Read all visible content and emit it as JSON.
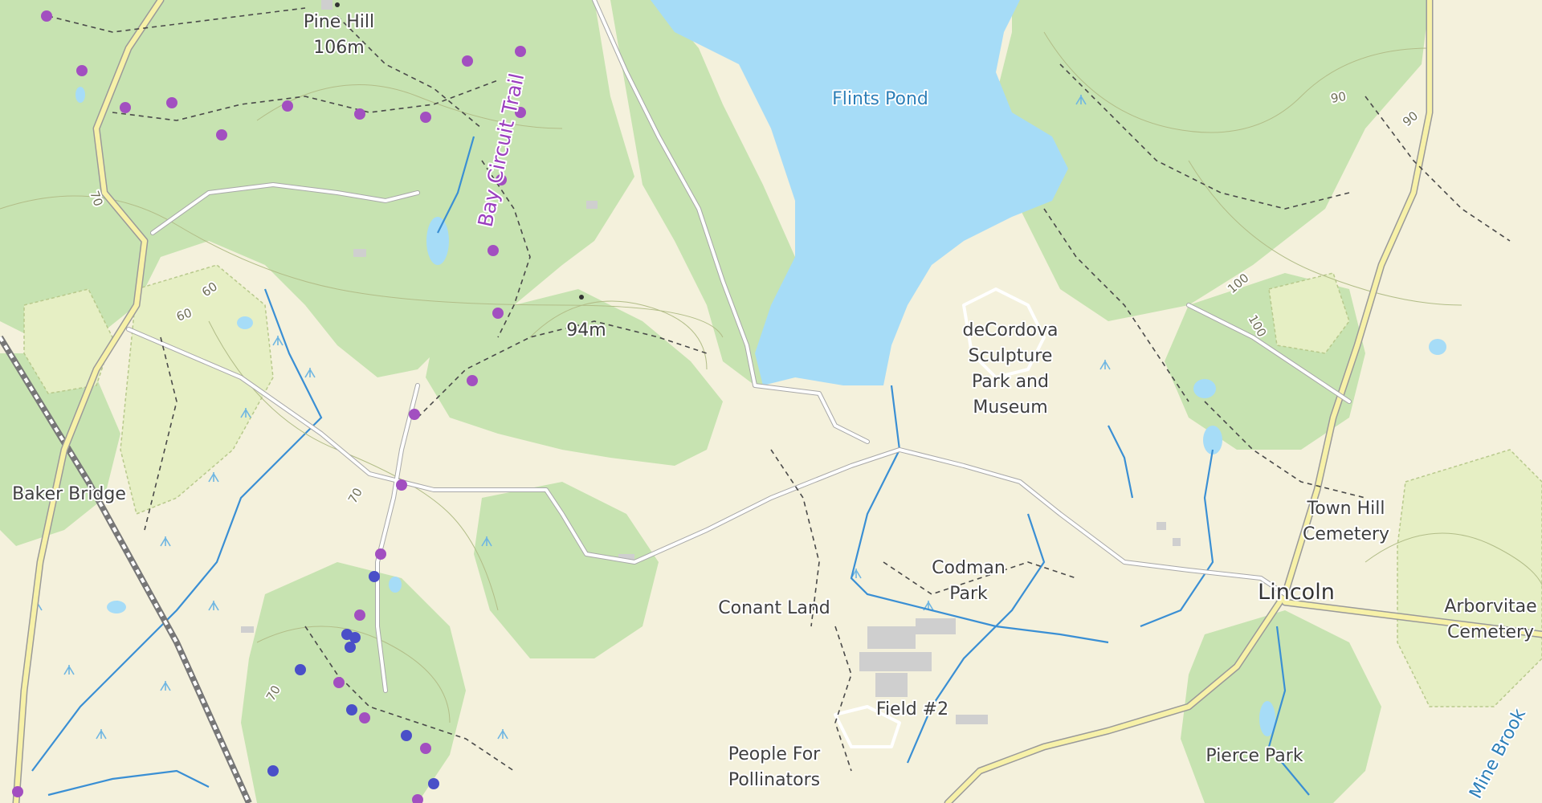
{
  "map": {
    "colors": {
      "background": "#f4f1dc",
      "forest": "#c7e3b1",
      "water": "#a6dcf7",
      "stream": "#3a8fd4",
      "road": "#ffffff",
      "major_road": "#f7f1a8",
      "trail_dash": "#4a4a4a",
      "trail_marker_purple": "#a24fc0",
      "trail_marker_blue": "#4a4fc8",
      "building": "#cfcfcf",
      "railway": "#777777"
    },
    "labels": {
      "pine_hill": "Pine Hill",
      "pine_hill_elev": "106m",
      "bay_circuit_trail": "Bay Circuit Trail",
      "flints_pond": "Flints Pond",
      "peak_94": "94m",
      "decordova_1": "deCordova",
      "decordova_2": "Sculpture",
      "decordova_3": "Park and",
      "decordova_4": "Museum",
      "baker_bridge": "Baker Bridge",
      "town_hill_1": "Town Hill",
      "town_hill_2": "Cemetery",
      "codman_1": "Codman",
      "codman_2": "Park",
      "conant_land": "Conant Land",
      "lincoln": "Lincoln",
      "arborvitae_1": "Arborvitae",
      "arborvitae_2": "Cemetery",
      "field_2": "Field #2",
      "pollinators_1": "People For",
      "pollinators_2": "Pollinators",
      "pierce_park": "Pierce Park",
      "mine_brook": "Mine Brook"
    },
    "contours": {
      "c70a": "70",
      "c60a": "60",
      "c60b": "60",
      "c70b": "70",
      "c70c": "70",
      "c90a": "90",
      "c90b": "90",
      "c100a": "100",
      "c100b": "100"
    }
  }
}
